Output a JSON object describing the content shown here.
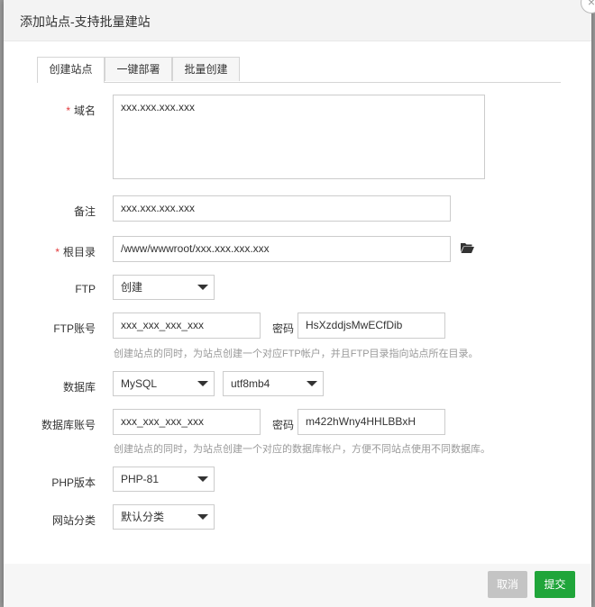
{
  "dialog": {
    "title": "添加站点-支持批量建站",
    "close_label": "×"
  },
  "tabs": [
    {
      "label": "创建站点",
      "active": true
    },
    {
      "label": "一键部署",
      "active": false
    },
    {
      "label": "批量创建",
      "active": false
    }
  ],
  "form": {
    "domain": {
      "label": "域名",
      "required_mark": "*",
      "value": "xxx.xxx.xxx.xxx"
    },
    "remark": {
      "label": "备注",
      "value": "xxx.xxx.xxx.xxx"
    },
    "root": {
      "label": "根目录",
      "required_mark": "*",
      "value": "/www/wwwroot/xxx.xxx.xxx.xxx",
      "icon": "folder-open-icon"
    },
    "ftp": {
      "label": "FTP",
      "selected": "创建"
    },
    "ftp_account": {
      "label": "FTP账号",
      "username": "xxx_xxx_xxx_xxx",
      "password_label": "密码",
      "password": "HsXzddjsMwECfDib",
      "hint": "创建站点的同时，为站点创建一个对应FTP帐户，并且FTP目录指向站点所在目录。"
    },
    "database": {
      "label": "数据库",
      "type_selected": "MySQL",
      "charset_selected": "utf8mb4"
    },
    "db_account": {
      "label": "数据库账号",
      "username": "xxx_xxx_xxx_xxx",
      "password_label": "密码",
      "password": "m422hWny4HHLBBxH",
      "hint": "创建站点的同时，为站点创建一个对应的数据库帐户，方便不同站点使用不同数据库。"
    },
    "php_version": {
      "label": "PHP版本",
      "selected": "PHP-81"
    },
    "category": {
      "label": "网站分类",
      "selected": "默认分类"
    }
  },
  "footer": {
    "cancel_label": "取消",
    "submit_label": "提交"
  },
  "colors": {
    "submit": "#20a53a",
    "required": "#e2383a",
    "header_bg": "#f3f3f3"
  }
}
